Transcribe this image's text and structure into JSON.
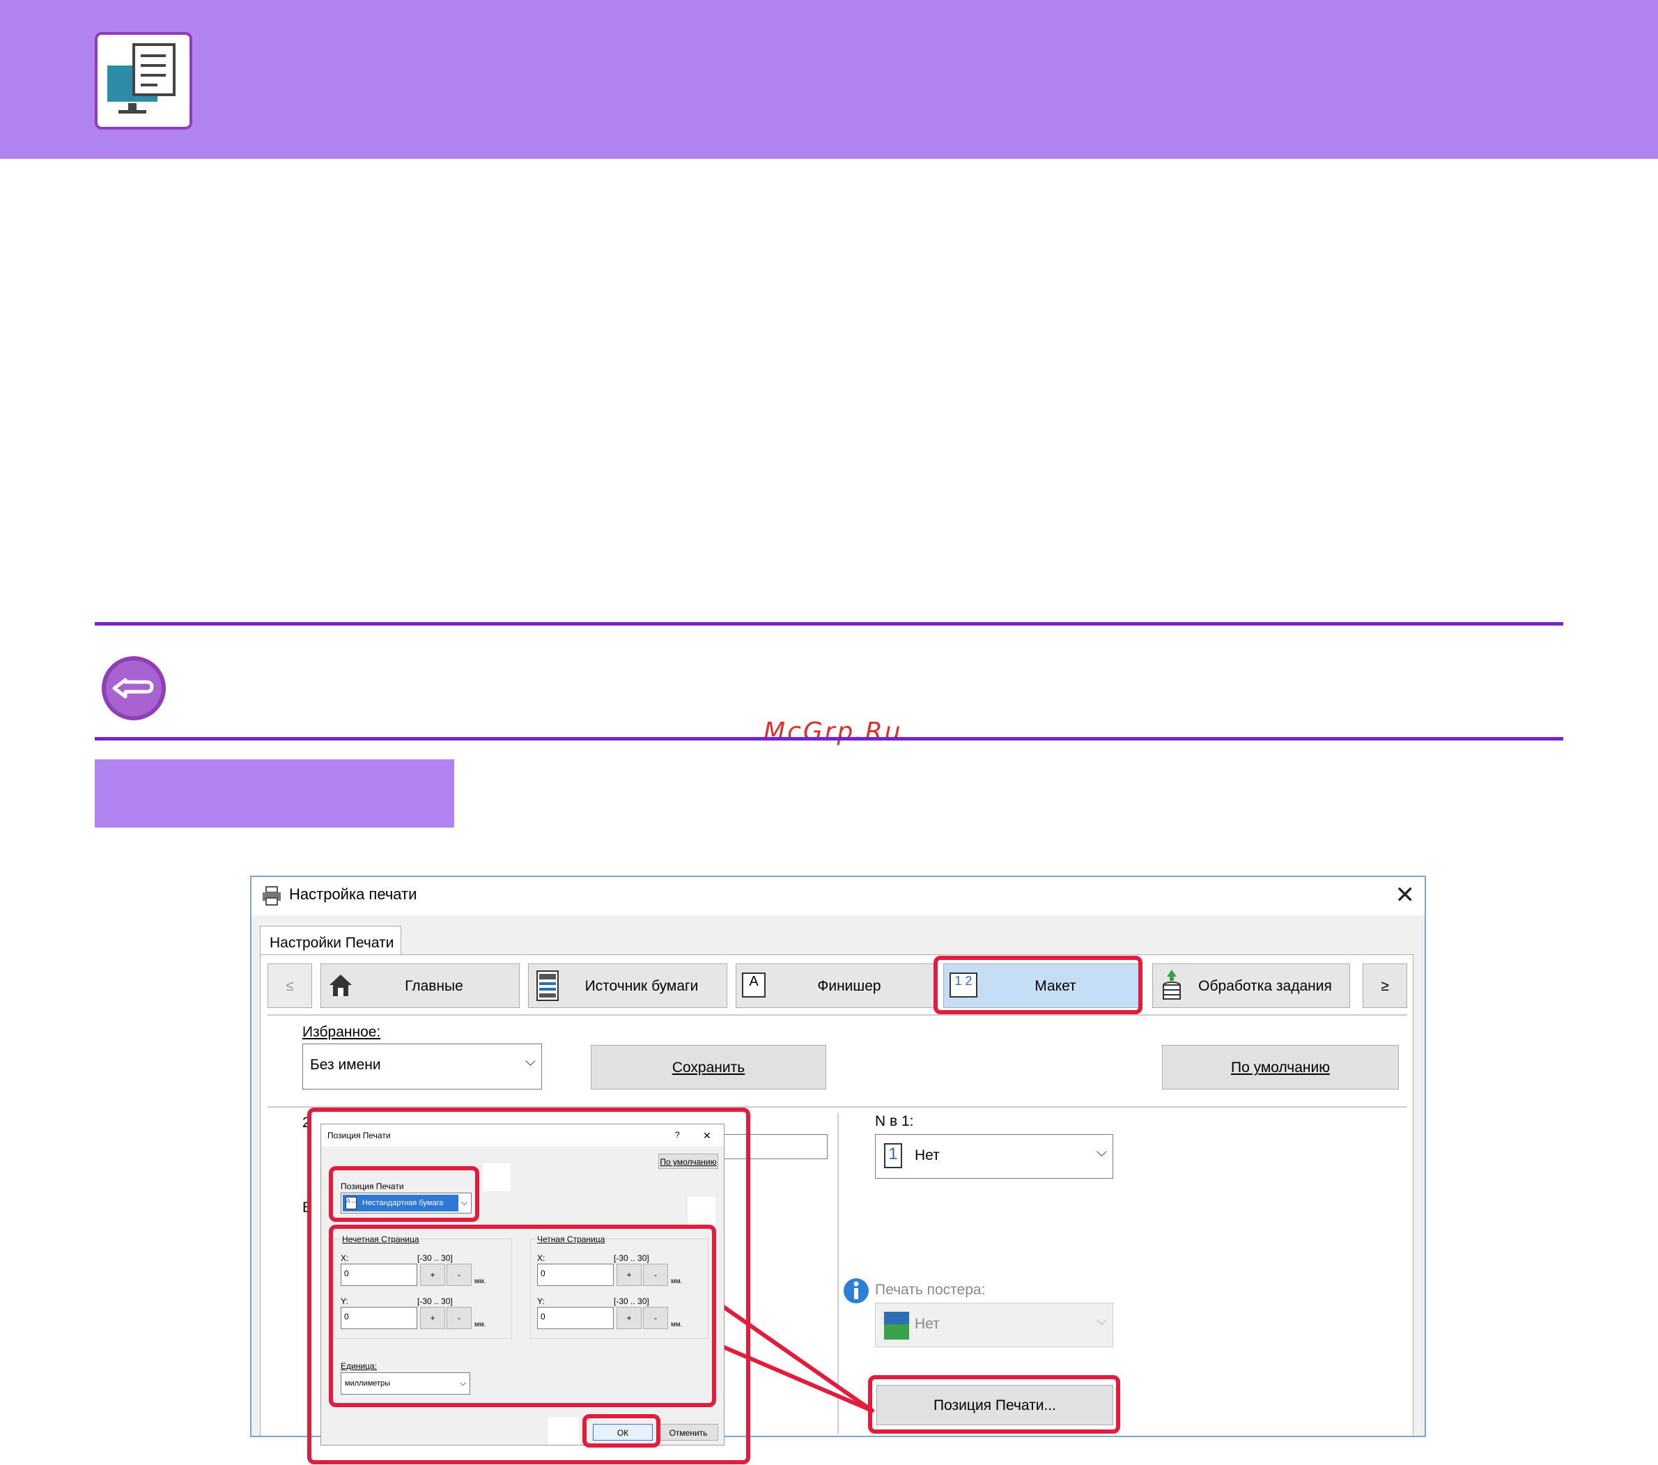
{
  "watermark": "McGrp.Ru",
  "window": {
    "title": "Настройка печати",
    "tab": "Настройки Печати",
    "nav": {
      "prev": "≤",
      "next": "≥",
      "tabs": [
        "Главные",
        "Источник бумаги",
        "Финишер",
        "Макет",
        "Обработка задания"
      ],
      "layout_icon_text": "1 2"
    },
    "favorites_label": "Избранное:",
    "favorites_value": "Без имени",
    "save_label": "Сохранить",
    "default_label": "По умолчанию",
    "n_in_1_label": "N в 1:",
    "n_in_1_value": "Нет",
    "n_in_1_icon_text": "1",
    "poster_label": "Печать постера:",
    "poster_value": "Нет",
    "print_position_button": "Позиция Печати...",
    "partial_label_1": "2",
    "partial_label_2": "Е"
  },
  "dialog": {
    "title": "Позиция Печати",
    "help": "?",
    "close": "✕",
    "default_button": "По умолчанию",
    "position_label": "Позиция Печати",
    "position_value": "Нестандартная бумага",
    "position_icon_text": "A↔",
    "odd_group": "Нечетная Страница",
    "even_group": "Четная Страница",
    "x_label": "X:",
    "y_label": "Y:",
    "range": "[-30 .. 30]",
    "odd_x": "0",
    "odd_y": "0",
    "even_x": "0",
    "even_y": "0",
    "plus": "+",
    "minus": "-",
    "unit_short": "мм.",
    "unit_label": "Единица:",
    "unit_value": "миллиметры",
    "ok": "ОК",
    "cancel": "Отменить"
  },
  "colors": {
    "band": "#b083f0",
    "rule": "#7b22d0",
    "highlight": "#e11c3c",
    "active_tab": "#c5def5"
  }
}
